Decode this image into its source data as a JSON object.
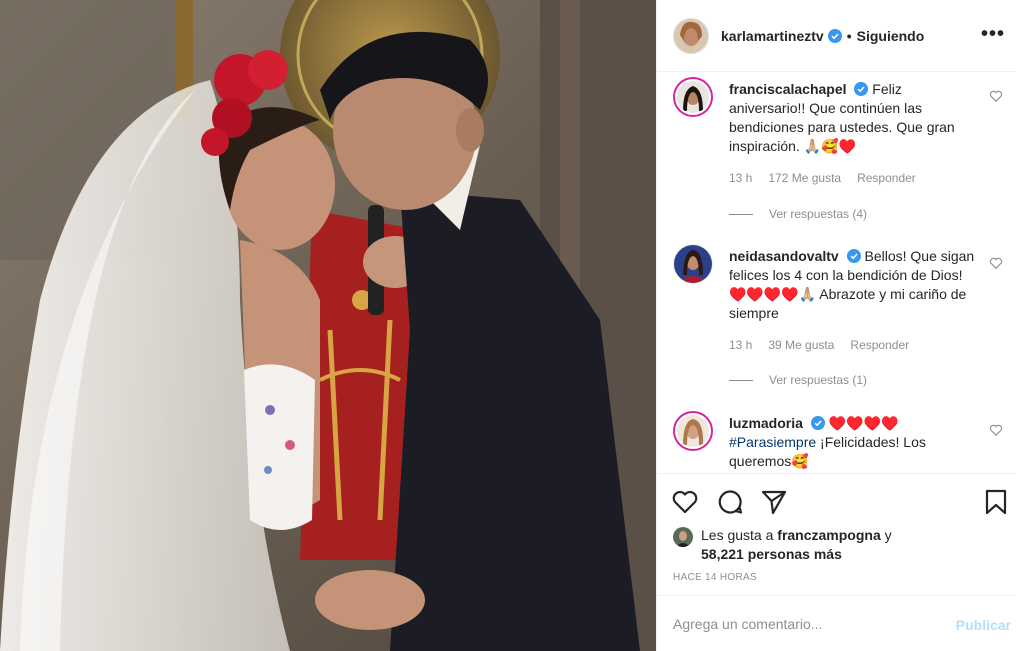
{
  "header": {
    "username": "karlamartineztv",
    "dot": "•",
    "follow_label": "Siguiendo",
    "more": "•••",
    "verified": true
  },
  "comments": [
    {
      "username": "franciscalachapel",
      "verified": true,
      "text": "Feliz aniversario!! Que continúen las bendiciones para ustedes. Que gran inspiración. 🙏🏼🥰♥️",
      "time": "13 h",
      "likes": "172 Me gusta",
      "reply": "Responder",
      "view_replies": "Ver respuestas (4)"
    },
    {
      "username": "neidasandovaltv",
      "verified": true,
      "text": "Bellos! Que sigan felices los 4 con la bendición de Dios!♥️♥️♥️♥️🙏🏼 Abrazote y mi cariño de siempre",
      "time": "13 h",
      "likes": "39 Me gusta",
      "reply": "Responder",
      "view_replies": "Ver respuestas (1)"
    },
    {
      "username": "luzmadoria",
      "verified": true,
      "text_suffix": "♥️♥️♥️♥️",
      "hashtag": "#Parasiempre",
      "text": "¡Felicidades! Los queremos🥰"
    }
  ],
  "likes": {
    "prefix": "Les gusta a",
    "user": "franczampogna",
    "connector": "y",
    "count": "58,221 personas más"
  },
  "time_ago": "HACE 14 HORAS",
  "add_comment": {
    "placeholder": "Agrega un comentario...",
    "publish": "Publicar"
  },
  "icons": {
    "like": "heart-icon",
    "comment": "comment-icon",
    "share": "paper-plane-icon",
    "save": "bookmark-icon"
  },
  "colors": {
    "verified": "#3897f0",
    "link": "#00376b",
    "publish_disabled": "#b2dffc",
    "heart_red": "#b0142a"
  }
}
